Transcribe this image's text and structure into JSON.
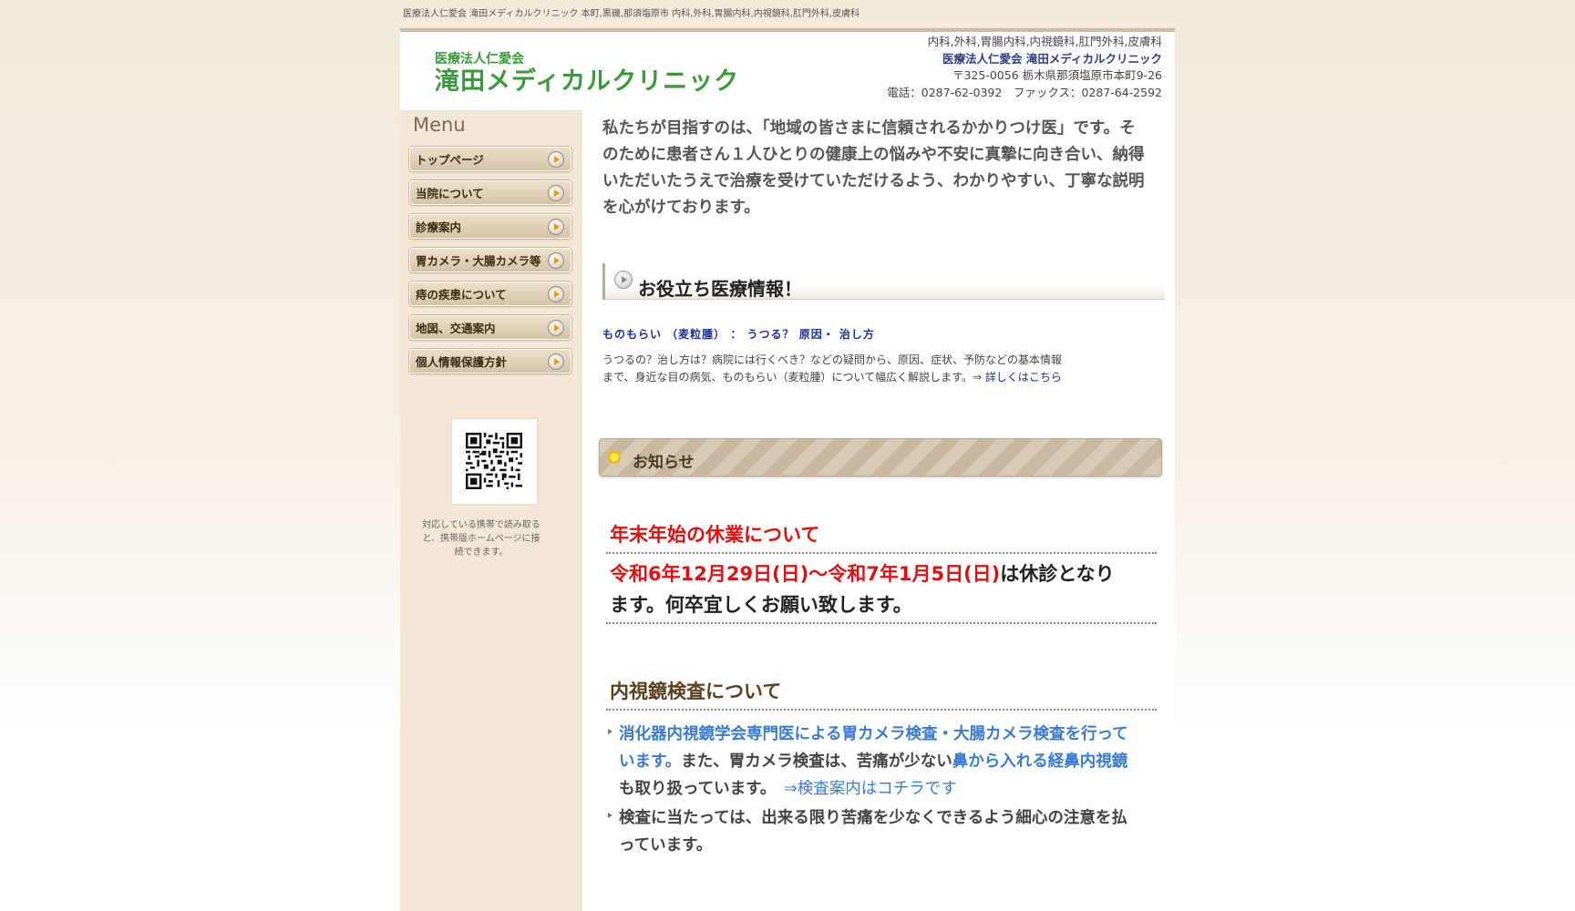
{
  "topbar": {
    "text": "医療法人仁愛会 滝田メディカルクリニック 本町,黒磯,那須塩原市 内科,外科,胃腸内科,内視鏡科,肛門外科,皮膚科"
  },
  "header": {
    "corp": "医療法人仁愛会",
    "name": "滝田メディカルクリニック",
    "departments": "内科,外科,胃腸内科,内視鏡科,肛門外科,皮膚科",
    "clinic_full": "医療法人仁愛会 滝田メディカルクリニック",
    "address": "〒325-0056 栃木県那須塩原市本町9-26",
    "phone": "電話：0287-62-0392　ファックス：0287-64-2592"
  },
  "sidebar": {
    "menu_title": "Menu",
    "items": [
      {
        "label": "トップページ"
      },
      {
        "label": "当院について"
      },
      {
        "label": "診療案内"
      },
      {
        "label": "胃カメラ・大腸カメラ等"
      },
      {
        "label": "痔の疾患について"
      },
      {
        "label": "地図、交通案内"
      },
      {
        "label": "個人情報保護方針"
      }
    ],
    "qr_text": "対応している携帯で読み取ると、携帯版ホームページに接続できます。"
  },
  "main": {
    "intro": "私たちが目指すのは、「地域の皆さまに信頼されるかかりつけ医」です。そのために患者さん１人ひとりの健康上の悩みや不安に真摯に向き合い、納得いただいたうえで治療を受けていただけるよう、わかりやすい、丁寧な説明を心がけております。",
    "info_heading": "お役立ち医療情報！",
    "article_link": "ものもらい （麦粒腫） ： うつる？ 原因・ 治し方",
    "article_desc": "うつるの？治し方は？病院には行くべき？などの疑問から、原因、症状、予防などの基本情報まで、身近な目の病気、ものもらい（麦粒腫）について幅広く解説します。⇒ ",
    "article_more": "詳しくはこちら",
    "notice_heading": "お知らせ",
    "notice1": {
      "title": "年末年始の休業について",
      "dates": "令和6年12月29日(日)～令和7年1月5日(日)",
      "rest": "は休診となります。何卒宜しくお願い致します。"
    },
    "notice2": {
      "title": "内視鏡検査について",
      "b1_blue": "消化器内視鏡学会専門医による胃カメラ検査・大腸カメラ検査を行っています。",
      "b1_mid": "また、胃カメラ検査は、苦痛が少ない",
      "b1_blue2": "鼻から入れる経鼻内視鏡",
      "b1_end": "も取り扱っています。　",
      "b1_link": "⇒検査案内はコチラです",
      "b2": "検査に当たっては、出来る限り苦痛を少なくできるよう細心の注意を払っています。"
    }
  }
}
